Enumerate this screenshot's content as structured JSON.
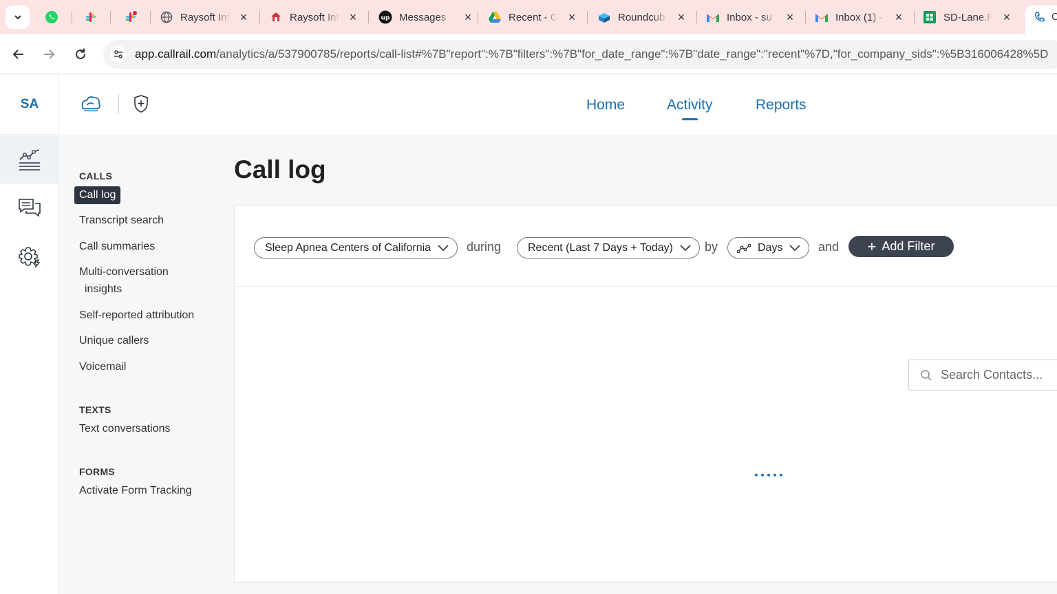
{
  "browser": {
    "tabs": [
      {
        "title": "Raysoft Inf",
        "icon": "globe-icon"
      },
      {
        "title": "Raysoft Inf",
        "icon": "raysoft-icon"
      },
      {
        "title": "Messages",
        "icon": "upwork-icon"
      },
      {
        "title": "Recent - G",
        "icon": "google-drive-icon"
      },
      {
        "title": "Roundcub",
        "icon": "roundcube-icon"
      },
      {
        "title": "Inbox - su",
        "icon": "gmail-icon"
      },
      {
        "title": "Inbox (1) -",
        "icon": "gmail-icon"
      },
      {
        "title": "SD-Lane.R",
        "icon": "google-sheets-icon"
      }
    ],
    "active_tab_title": "C",
    "url_host": "app.callrail.com",
    "url_path": "/analytics/a/537900785/reports/call-list#%7B\"report\":%7B\"filters\":%7B\"for_date_range\":%7B\"date_range\":\"recent\"%7D,\"for_company_sids\":%5B316006428%5D"
  },
  "app": {
    "user_initials": "SA",
    "topnav": {
      "home": "Home",
      "activity": "Activity",
      "reports": "Reports"
    },
    "subnav": {
      "calls_heading": "CALLS",
      "calls_items": [
        "Call log",
        "Transcript search",
        "Call summaries",
        "Multi-conversation",
        "insights",
        "Self-reported attribution",
        "Unique callers",
        "Voicemail"
      ],
      "texts_heading": "TEXTS",
      "texts_items": [
        "Text conversations"
      ],
      "forms_heading": "FORMS",
      "forms_items": [
        "Activate Form Tracking"
      ]
    },
    "page_title": "Call log",
    "filters": {
      "company": "Sleep Apnea Centers of California",
      "during_label": "during",
      "date_range": "Recent (Last 7 Days + Today)",
      "by_label": "by",
      "interval": "Days",
      "and_label": "and",
      "add_filter": "Add Filter"
    },
    "search": {
      "placeholder": "Search Contacts..."
    },
    "colors": {
      "brand_blue": "#1a6fb0",
      "dark_button": "#3d4350",
      "tabbar_bg": "#fde4e4"
    }
  }
}
